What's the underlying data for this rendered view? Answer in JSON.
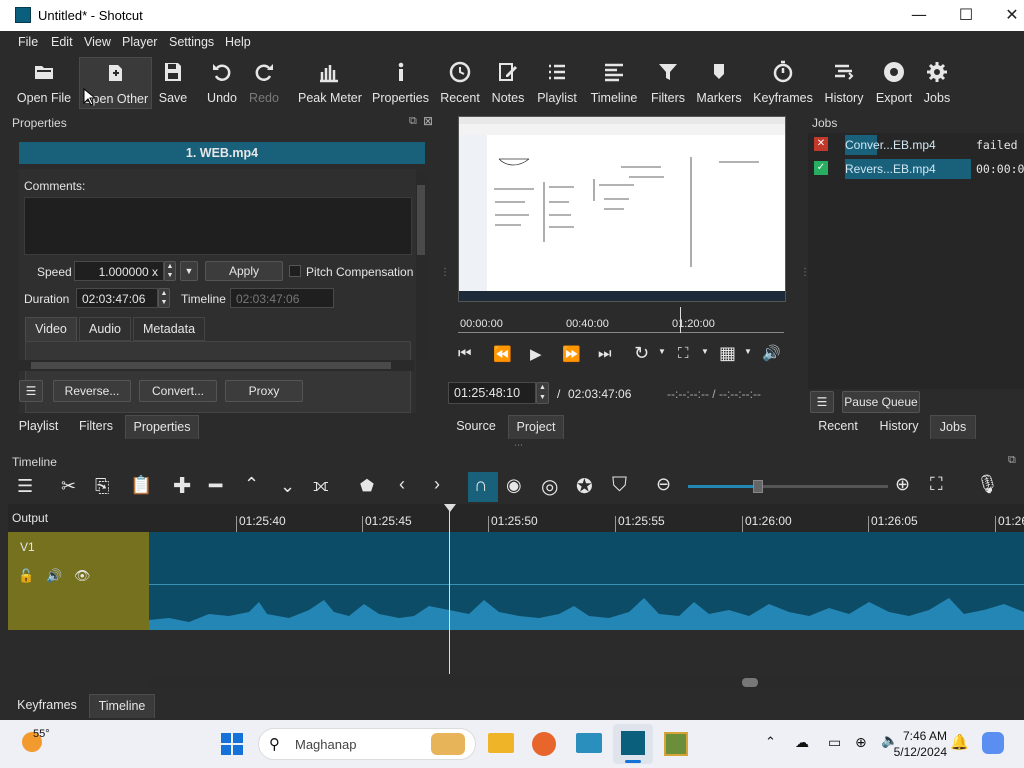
{
  "window": {
    "title": "Untitled* - Shotcut",
    "minimize": "—",
    "maximize": "☐",
    "close": "✕"
  },
  "menu": [
    "File",
    "Edit",
    "View",
    "Player",
    "Settings",
    "Help"
  ],
  "toolbar": [
    {
      "label": "Open File",
      "icon": "folder-icon"
    },
    {
      "label": "Open Other",
      "icon": "open-other-icon"
    },
    {
      "label": "Save",
      "icon": "save-icon"
    },
    {
      "label": "Undo",
      "icon": "undo-icon"
    },
    {
      "label": "Redo",
      "icon": "redo-icon"
    },
    {
      "label": "Peak Meter",
      "icon": "peak-meter-icon"
    },
    {
      "label": "Properties",
      "icon": "info-icon"
    },
    {
      "label": "Recent",
      "icon": "clock-icon"
    },
    {
      "label": "Notes",
      "icon": "notes-icon"
    },
    {
      "label": "Playlist",
      "icon": "list-icon"
    },
    {
      "label": "Timeline",
      "icon": "timeline-icon"
    },
    {
      "label": "Filters",
      "icon": "filter-icon"
    },
    {
      "label": "Markers",
      "icon": "marker-icon"
    },
    {
      "label": "Keyframes",
      "icon": "stopwatch-icon"
    },
    {
      "label": "History",
      "icon": "history-icon"
    },
    {
      "label": "Export",
      "icon": "export-icon"
    },
    {
      "label": "Jobs",
      "icon": "gear-icon"
    }
  ],
  "properties": {
    "header": "Properties",
    "clip_name": "1. WEB.mp4",
    "comments_label": "Comments:",
    "speed_label": "Speed",
    "speed_value": "1.000000 x",
    "apply_label": "Apply",
    "pitch_label": "Pitch Compensation",
    "duration_label": "Duration",
    "duration_value": "02:03:47:06",
    "timeline_label": "Timeline",
    "timeline_value": "02:03:47:06",
    "tabs": [
      "Video",
      "Audio",
      "Metadata"
    ],
    "buttons": [
      "Reverse...",
      "Convert...",
      "Proxy"
    ],
    "bottom_tabs": [
      "Playlist",
      "Filters",
      "Properties"
    ]
  },
  "player": {
    "ruler_labels": [
      "00:00:00",
      "00:40:00",
      "01:20:00"
    ],
    "position": 0.68,
    "current_time": "01:25:48:10",
    "separator": "/",
    "total_time": "02:03:47:06",
    "in_out": "--:--:--:-- / --:--:--:--",
    "tabs": [
      "Source",
      "Project"
    ]
  },
  "jobs": {
    "header": "Jobs",
    "items": [
      {
        "name": "Conver...EB.mp4",
        "status": "failed",
        "state": "failed"
      },
      {
        "name": "Revers...EB.mp4",
        "status": "00:00:0",
        "state": "done"
      }
    ],
    "pause_label": "Pause Queue",
    "bottom_tabs": [
      "Recent",
      "History",
      "Jobs"
    ]
  },
  "timeline": {
    "header": "Timeline",
    "output_label": "Output",
    "track_name": "V1",
    "ruler": [
      "01:25:40",
      "01:25:45",
      "01:25:50",
      "01:25:55",
      "01:26:00",
      "01:26:05",
      "01:26"
    ],
    "zoom_fraction": 0.35
  },
  "bottom_tabs": [
    "Keyframes",
    "Timeline"
  ],
  "taskbar": {
    "weather": "55°",
    "search_text": "Maghanap",
    "time": "7:46 AM",
    "date": "5/12/2024"
  },
  "colors": {
    "accent": "#19607b",
    "track": "#75711f",
    "clip": "#0d4c66",
    "wave": "#2486b4"
  }
}
